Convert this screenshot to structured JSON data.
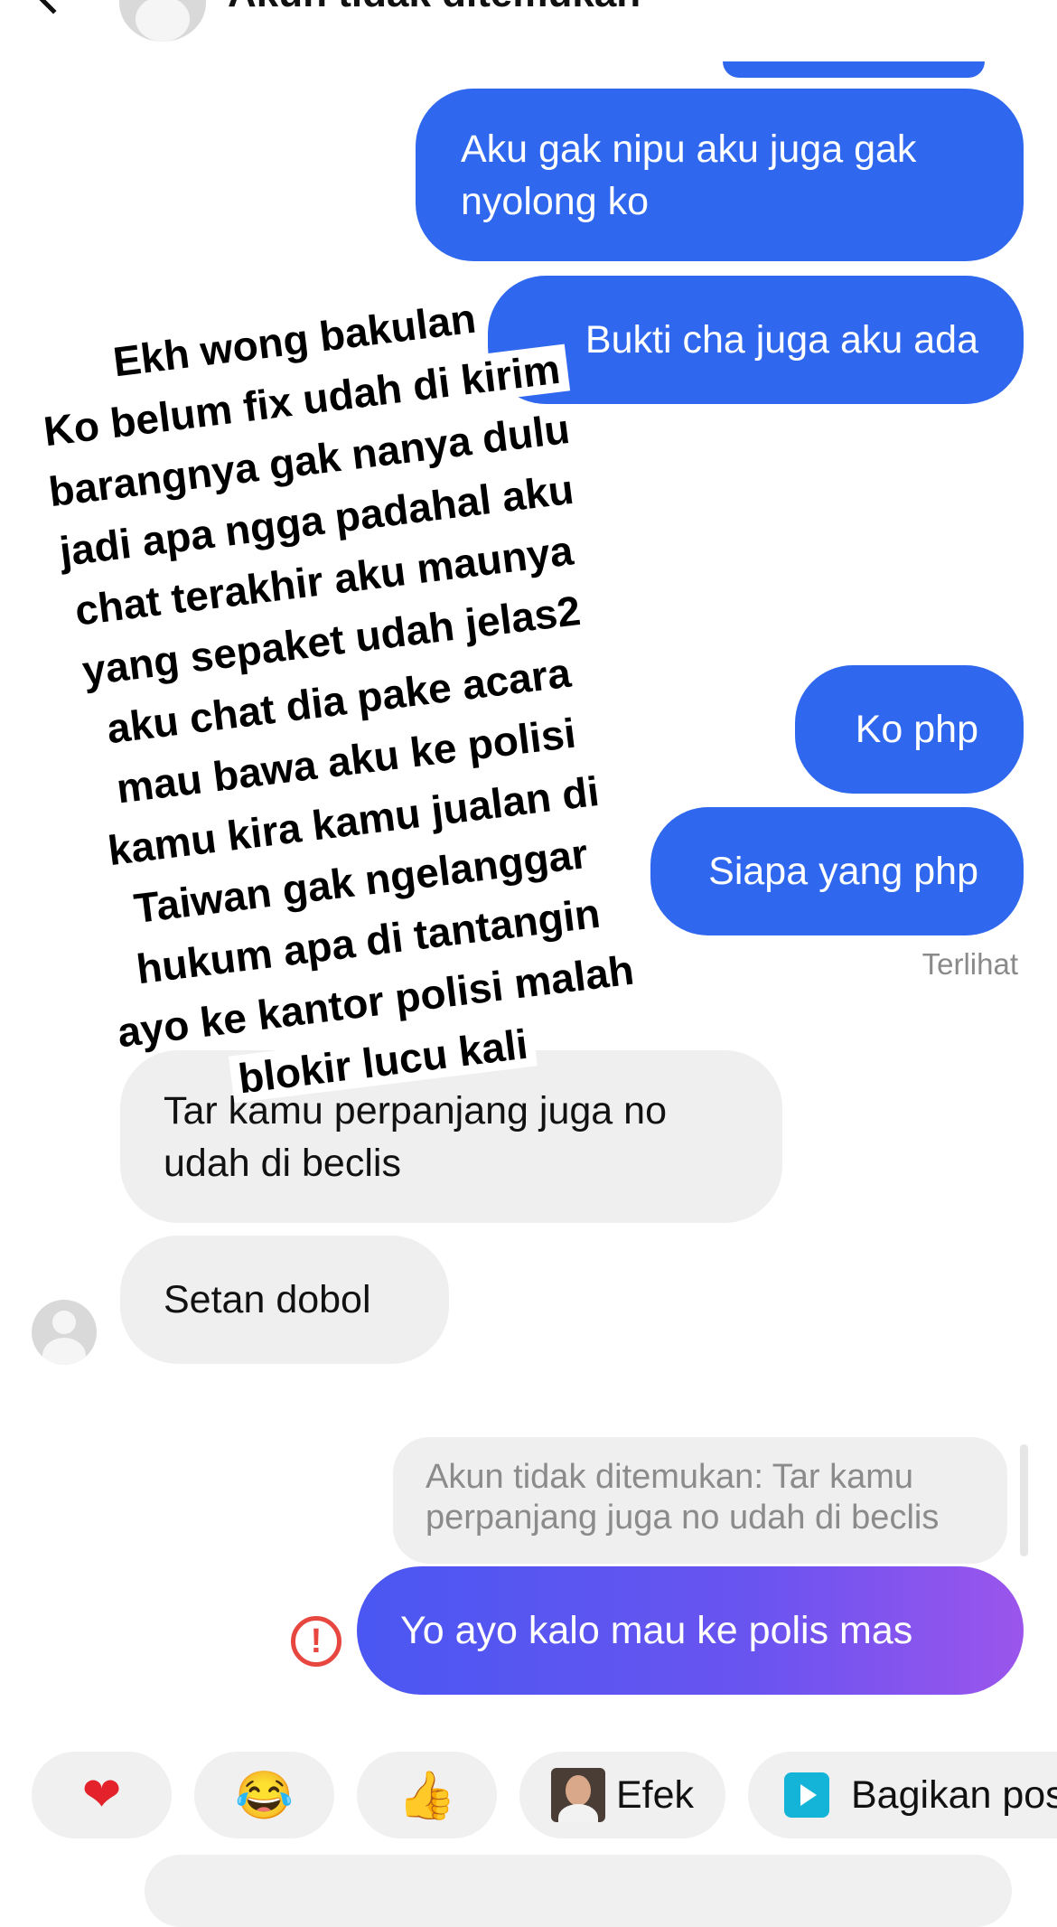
{
  "header": {
    "title": "Akun tidak ditemukan"
  },
  "messages": {
    "sent_1": "Aku gak nipu aku juga gak nyolong ko",
    "sent_2": "Bukti cha juga aku ada",
    "sent_3": "Ko php",
    "sent_4": "Siapa yang php",
    "seen_label": "Terlihat",
    "recv_1": "Tar kamu perpanjang juga no udah di beclis",
    "recv_2": "Setan dobol",
    "reply_preview": "Akun tidak ditemukan: Tar kamu perpanjang juga no udah di beclis",
    "sent_failed": "Yo ayo kalo mau ke polis mas"
  },
  "overlay_text": [
    "Ekh wong bakulan",
    "Ko belum fix udah di kirim",
    "barangnya gak nanya dulu",
    "jadi apa ngga padahal aku",
    "chat terakhir aku maunya",
    "yang sepaket udah jelas2",
    "aku chat dia pake acara",
    "mau bawa aku ke polisi",
    "kamu kira kamu jualan di",
    "Taiwan gak ngelanggar",
    "hukum apa di tantangin",
    "ayo ke kantor polisi malah",
    "blokir lucu kali"
  ],
  "quick_replies": {
    "heart": "❤",
    "laugh": "😂",
    "thumbs": "👍",
    "effect_label": "Efek",
    "share_label": "Bagikan pos"
  },
  "error_glyph": "!",
  "colors": {
    "sent_bubble": "#2f68ef",
    "received_bubble": "#efefef",
    "error": "#e8473f",
    "gradient_start": "#4a57f2",
    "gradient_end": "#9b55ec"
  }
}
